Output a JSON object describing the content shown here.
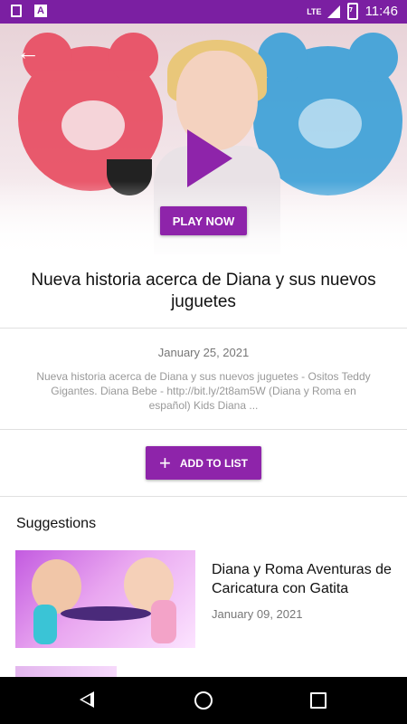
{
  "status_bar": {
    "time": "11:46",
    "network": "LTE",
    "left_icon_letter": "A"
  },
  "hero": {
    "play_now_label": "PLAY NOW"
  },
  "video": {
    "title": "Nueva historia acerca de Diana y sus nuevos juguetes",
    "date": "January 25, 2021",
    "description": "Nueva historia acerca de Diana y sus nuevos juguetes - Ositos Teddy Gigantes. Diana Bebe - http://bit.ly/2t8am5W (Diana y Roma en español) Kids Diana ..."
  },
  "actions": {
    "add_to_list_label": "ADD TO LIST",
    "add_icon": "+"
  },
  "suggestions": {
    "heading": "Suggestions",
    "items": [
      {
        "title": "Diana y Roma Aventuras de Caricatura con Gatita",
        "date": "January 09, 2021"
      }
    ]
  },
  "colors": {
    "status_bar": "#7b1fa2",
    "accent": "#8e24aa"
  }
}
